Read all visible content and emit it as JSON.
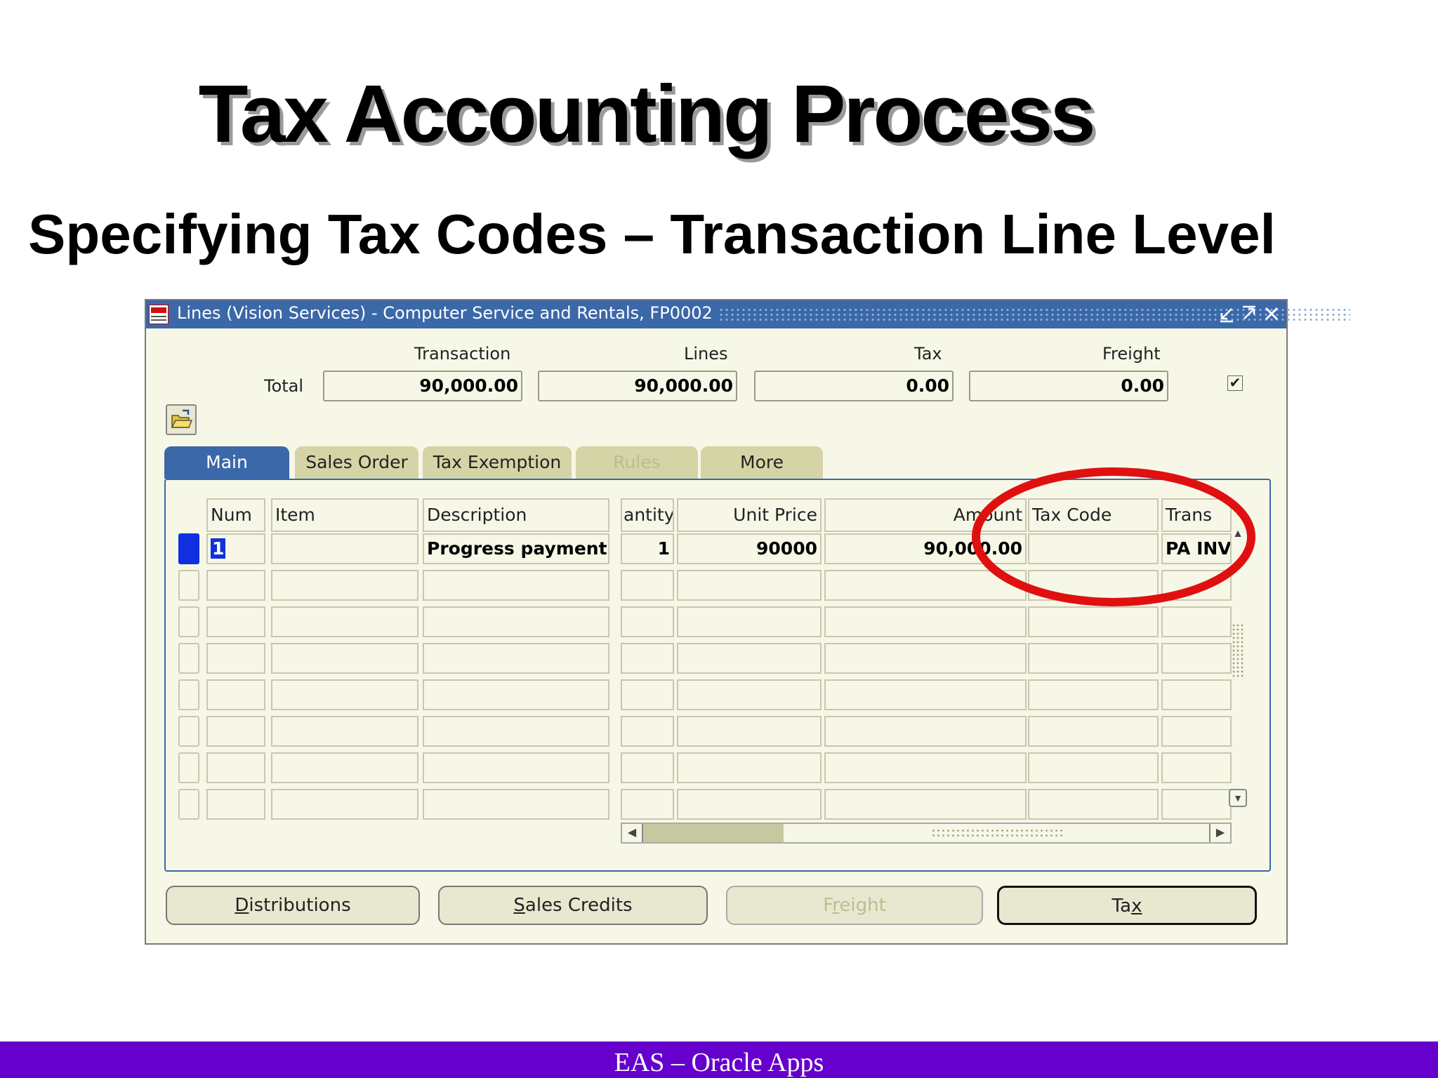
{
  "slide": {
    "title": "Tax Accounting Process",
    "subtitle": "Specifying Tax Codes – Transaction Line Level",
    "footer": "EAS – Oracle Apps"
  },
  "window": {
    "title": "Lines (Vision Services) - Computer Service and Rentals, FP0002",
    "controls": [
      "minimize-icon",
      "maximize-icon",
      "close-icon"
    ]
  },
  "totals": {
    "row_label": "Total",
    "headers": {
      "transaction": "Transaction",
      "lines": "Lines",
      "tax": "Tax",
      "freight": "Freight"
    },
    "values": {
      "transaction": "90,000.00",
      "lines": "90,000.00",
      "tax": "0.00",
      "freight": "0.00"
    },
    "checkbox_checked": true
  },
  "tabs": [
    {
      "label": "Main",
      "active": true
    },
    {
      "label": "Sales Order",
      "active": false
    },
    {
      "label": "Tax Exemption",
      "active": false
    },
    {
      "label": "Rules",
      "active": false,
      "disabled": true
    },
    {
      "label": "More",
      "active": false
    }
  ],
  "table": {
    "columns": {
      "num": "Num",
      "item": "Item",
      "description": "Description",
      "quantity": "antity",
      "unit_price": "Unit Price",
      "amount": "Amount",
      "tax_code": "Tax Code",
      "trans": "Trans"
    },
    "rows": [
      {
        "num": "1",
        "item": "",
        "description": "Progress payment",
        "quantity": "1",
        "unit_price": "90000",
        "amount": "90,000.00",
        "tax_code": "",
        "trans": "PA INV"
      }
    ],
    "empty_rows": 7
  },
  "buttons": {
    "distributions": {
      "pre": "",
      "key": "D",
      "post": "istributions"
    },
    "sales_credits": {
      "pre": "",
      "key": "S",
      "post": "ales Credits"
    },
    "freight": {
      "pre": "F",
      "key": "r",
      "post": "eight"
    },
    "tax": {
      "pre": "Ta",
      "key": "x",
      "post": ""
    }
  },
  "colors": {
    "accent": "#3b68a8",
    "footer": "#6600cc",
    "highlight": "#e01010",
    "window_bg": "#f7f7e7",
    "selection": "#1030e0"
  }
}
